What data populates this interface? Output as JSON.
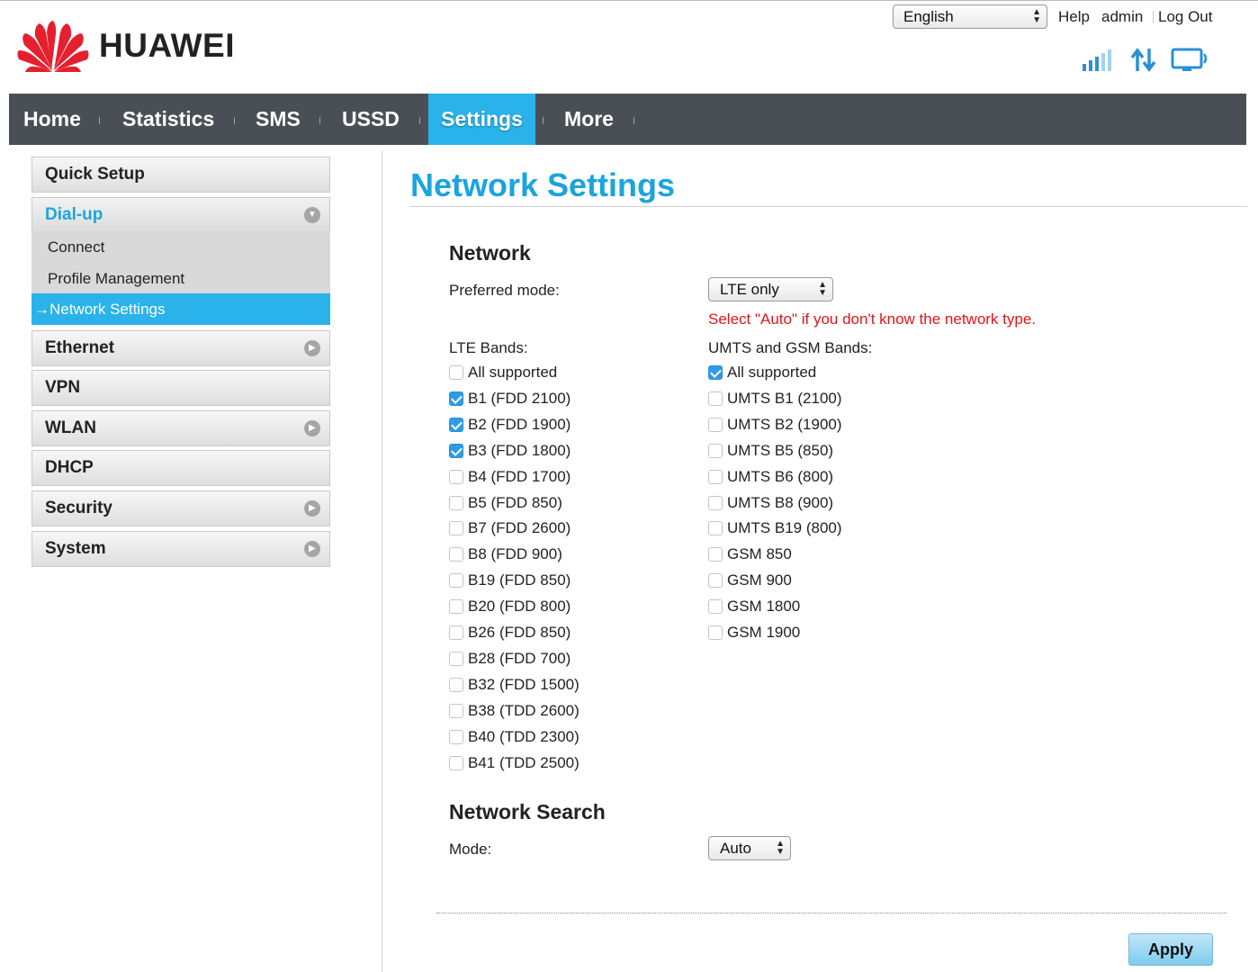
{
  "brand": {
    "name": "HUAWEI",
    "accent": "#29b3ea",
    "logo_color": "#e5202e"
  },
  "header": {
    "language": "English",
    "help": "Help",
    "user": "admin",
    "logout": "Log Out",
    "icons": [
      "signal-strength-icon",
      "data-transfer-icon",
      "network-device-icon"
    ]
  },
  "nav": {
    "items": [
      "Home",
      "Statistics",
      "SMS",
      "USSD",
      "Settings",
      "More"
    ],
    "active": "Settings"
  },
  "sidebar": {
    "quick_setup": "Quick Setup",
    "dialup": "Dial-up",
    "dialup_sub": [
      "Connect",
      "Profile Management",
      "Network Settings"
    ],
    "active_sub_prefix": "→",
    "ethernet": "Ethernet",
    "vpn": "VPN",
    "wlan": "WLAN",
    "dhcp": "DHCP",
    "security": "Security",
    "system": "System"
  },
  "main": {
    "title": "Network Settings",
    "network_section": "Network",
    "preferred_mode_label": "Preferred mode:",
    "preferred_mode_value": "LTE only",
    "hint": "Select \"Auto\" if you don't know the network type.",
    "lte_label": "LTE Bands:",
    "umts_label": "UMTS and GSM Bands:",
    "lte_bands": [
      {
        "label": "All supported",
        "checked": false
      },
      {
        "label": "B1 (FDD 2100)",
        "checked": true
      },
      {
        "label": "B2 (FDD 1900)",
        "checked": true
      },
      {
        "label": "B3 (FDD 1800)",
        "checked": true
      },
      {
        "label": "B4 (FDD 1700)",
        "checked": false
      },
      {
        "label": "B5 (FDD 850)",
        "checked": false
      },
      {
        "label": "B7 (FDD 2600)",
        "checked": false
      },
      {
        "label": "B8 (FDD 900)",
        "checked": false
      },
      {
        "label": "B19 (FDD 850)",
        "checked": false
      },
      {
        "label": "B20 (FDD 800)",
        "checked": false
      },
      {
        "label": "B26 (FDD 850)",
        "checked": false
      },
      {
        "label": "B28 (FDD 700)",
        "checked": false
      },
      {
        "label": "B32 (FDD 1500)",
        "checked": false
      },
      {
        "label": "B38 (TDD 2600)",
        "checked": false
      },
      {
        "label": "B40 (TDD 2300)",
        "checked": false
      },
      {
        "label": "B41 (TDD 2500)",
        "checked": false
      }
    ],
    "umts_bands": [
      {
        "label": "All supported",
        "checked": true
      },
      {
        "label": "UMTS B1 (2100)",
        "checked": false
      },
      {
        "label": "UMTS B2 (1900)",
        "checked": false
      },
      {
        "label": "UMTS B5 (850)",
        "checked": false
      },
      {
        "label": "UMTS B6 (800)",
        "checked": false
      },
      {
        "label": "UMTS B8 (900)",
        "checked": false
      },
      {
        "label": "UMTS B19 (800)",
        "checked": false
      },
      {
        "label": "GSM 850",
        "checked": false
      },
      {
        "label": "GSM 900",
        "checked": false
      },
      {
        "label": "GSM 1800",
        "checked": false
      },
      {
        "label": "GSM 1900",
        "checked": false
      }
    ],
    "search_section": "Network Search",
    "mode_label": "Mode:",
    "mode_value": "Auto",
    "apply": "Apply"
  }
}
